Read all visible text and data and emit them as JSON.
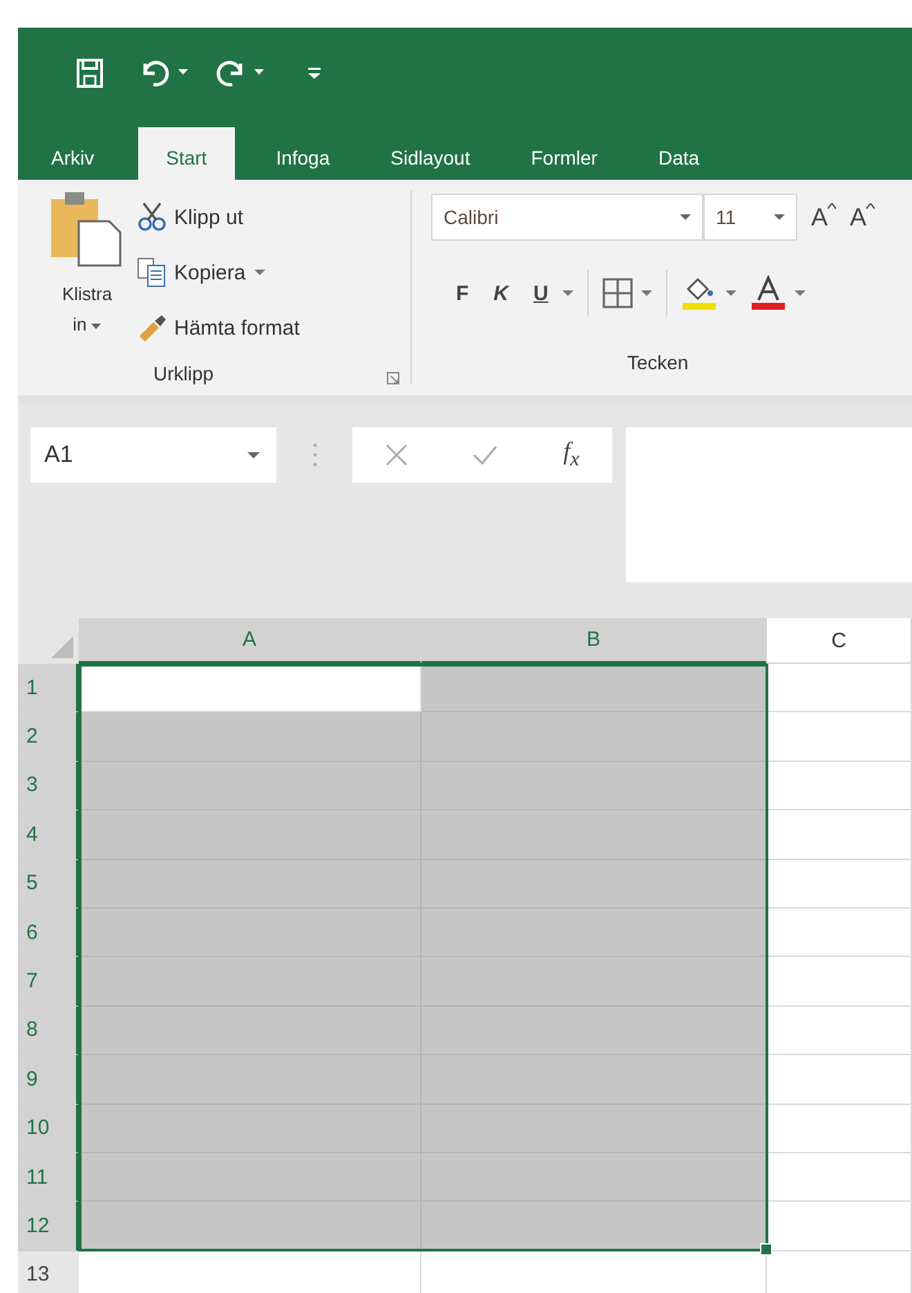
{
  "tabs": [
    {
      "label": "Arkiv",
      "selected": false
    },
    {
      "label": "Start",
      "selected": true
    },
    {
      "label": "Infoga",
      "selected": false
    },
    {
      "label": "Sidlayout",
      "selected": false
    },
    {
      "label": "Formler",
      "selected": false
    },
    {
      "label": "Data",
      "selected": false
    }
  ],
  "clipboard": {
    "paste": [
      "Klistra",
      "in"
    ],
    "cut": "Klipp ut",
    "copy": "Kopiera",
    "format_painter": "Hämta format",
    "group_label": "Urklipp"
  },
  "font": {
    "name": "Calibri",
    "size": "11",
    "grow": "A",
    "shrink": "A",
    "bold": "F",
    "italic": "K",
    "underline": "U",
    "group_label": "Tecken"
  },
  "name_box": "A1",
  "formula_fx": "f$_{x}$",
  "columns": [
    {
      "label": "A",
      "selected": true
    },
    {
      "label": "B",
      "selected": true
    },
    {
      "label": "C",
      "selected": false
    }
  ],
  "rows": [
    {
      "label": "1",
      "selected": true,
      "cells": [
        {
          "active": true,
          "selected": true
        },
        {
          "active": false,
          "selected": true
        },
        {
          "active": false,
          "selected": false
        }
      ]
    },
    {
      "label": "2",
      "selected": true,
      "cells": [
        {
          "active": false,
          "selected": true
        },
        {
          "active": false,
          "selected": true
        },
        {
          "active": false,
          "selected": false
        }
      ]
    },
    {
      "label": "3",
      "selected": true,
      "cells": [
        {
          "active": false,
          "selected": true
        },
        {
          "active": false,
          "selected": true
        },
        {
          "active": false,
          "selected": false
        }
      ]
    },
    {
      "label": "4",
      "selected": true,
      "cells": [
        {
          "active": false,
          "selected": true
        },
        {
          "active": false,
          "selected": true
        },
        {
          "active": false,
          "selected": false
        }
      ]
    },
    {
      "label": "5",
      "selected": true,
      "cells": [
        {
          "active": false,
          "selected": true
        },
        {
          "active": false,
          "selected": true
        },
        {
          "active": false,
          "selected": false
        }
      ]
    },
    {
      "label": "6",
      "selected": true,
      "cells": [
        {
          "active": false,
          "selected": true
        },
        {
          "active": false,
          "selected": true
        },
        {
          "active": false,
          "selected": false
        }
      ]
    },
    {
      "label": "7",
      "selected": true,
      "cells": [
        {
          "active": false,
          "selected": true
        },
        {
          "active": false,
          "selected": true
        },
        {
          "active": false,
          "selected": false
        }
      ]
    },
    {
      "label": "8",
      "selected": true,
      "cells": [
        {
          "active": false,
          "selected": true
        },
        {
          "active": false,
          "selected": true
        },
        {
          "active": false,
          "selected": false
        }
      ]
    },
    {
      "label": "9",
      "selected": true,
      "cells": [
        {
          "active": false,
          "selected": true
        },
        {
          "active": false,
          "selected": true
        },
        {
          "active": false,
          "selected": false
        }
      ]
    },
    {
      "label": "10",
      "selected": true,
      "cells": [
        {
          "active": false,
          "selected": true
        },
        {
          "active": false,
          "selected": true
        },
        {
          "active": false,
          "selected": false
        }
      ]
    },
    {
      "label": "11",
      "selected": true,
      "cells": [
        {
          "active": false,
          "selected": true
        },
        {
          "active": false,
          "selected": true
        },
        {
          "active": false,
          "selected": false
        }
      ]
    },
    {
      "label": "12",
      "selected": true,
      "cells": [
        {
          "active": false,
          "selected": true
        },
        {
          "active": false,
          "selected": true
        },
        {
          "active": false,
          "selected": false
        }
      ]
    },
    {
      "label": "13",
      "selected": false,
      "cells": [
        {
          "active": false,
          "selected": false
        },
        {
          "active": false,
          "selected": false
        },
        {
          "active": false,
          "selected": false
        }
      ]
    }
  ]
}
